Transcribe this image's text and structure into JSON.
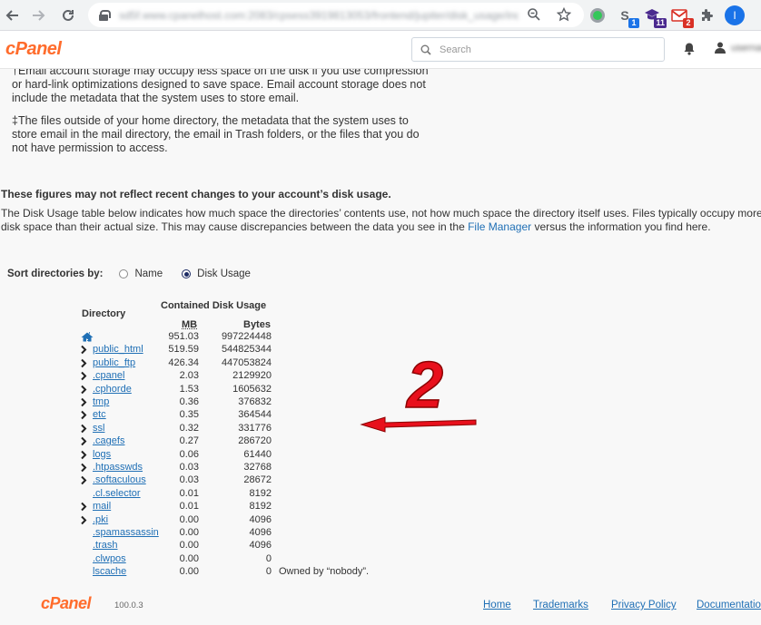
{
  "browser": {
    "url": "sd5f.www.cpanelhost.com:2083/cpsess3919813053/frontend/jupiter/disk_usage/index.html",
    "badges": {
      "ext_s": "1",
      "ext_grad": "11",
      "ext_mail": "2"
    },
    "profile_initial": "I"
  },
  "header": {
    "logo": "cPanel",
    "search_placeholder": "Search",
    "user_name": "username"
  },
  "notes": {
    "storage_note": "†Email account storage may occupy less space on the disk if you use compression or hard-link optimizations designed to save space. Email account storage does not include the metadata that the system uses to store email.",
    "outside_note": "‡The files outside of your home directory, the metadata that the system uses to store email in the mail directory, the email in Trash folders, or the files that you do not have permission to access."
  },
  "warning_heading": "These figures may not reflect recent changes to your account’s disk usage.",
  "description": {
    "before": "The Disk Usage table below indicates how much space the directories’ contents use, not how much space the directory itself uses. Files typically occupy more disk space than their actual size. This may cause discrepancies between the data you see in the ",
    "link": "File Manager",
    "after": " versus the information you find here."
  },
  "sort": {
    "label": "Sort directories by:",
    "options": [
      {
        "label": "Name",
        "checked": false
      },
      {
        "label": "Disk Usage",
        "checked": true
      }
    ]
  },
  "table": {
    "col_directory": "Directory",
    "col_contained": "Contained Disk Usage",
    "col_mb": "MB",
    "col_bytes": "Bytes",
    "rows": [
      {
        "name": "/",
        "mb": "951.03",
        "bytes": "997224448",
        "expandable": false,
        "home": true,
        "note": ""
      },
      {
        "name": "public_html",
        "mb": "519.59",
        "bytes": "544825344",
        "expandable": true,
        "home": false,
        "note": ""
      },
      {
        "name": "public_ftp",
        "mb": "426.34",
        "bytes": "447053824",
        "expandable": true,
        "home": false,
        "note": ""
      },
      {
        "name": ".cpanel",
        "mb": "2.03",
        "bytes": "2129920",
        "expandable": true,
        "home": false,
        "note": ""
      },
      {
        "name": ".cphorde",
        "mb": "1.53",
        "bytes": "1605632",
        "expandable": true,
        "home": false,
        "note": ""
      },
      {
        "name": "tmp",
        "mb": "0.36",
        "bytes": "376832",
        "expandable": true,
        "home": false,
        "note": ""
      },
      {
        "name": "etc",
        "mb": "0.35",
        "bytes": "364544",
        "expandable": true,
        "home": false,
        "note": ""
      },
      {
        "name": "ssl",
        "mb": "0.32",
        "bytes": "331776",
        "expandable": true,
        "home": false,
        "note": ""
      },
      {
        "name": ".cagefs",
        "mb": "0.27",
        "bytes": "286720",
        "expandable": true,
        "home": false,
        "note": ""
      },
      {
        "name": "logs",
        "mb": "0.06",
        "bytes": "61440",
        "expandable": true,
        "home": false,
        "note": ""
      },
      {
        "name": ".htpasswds",
        "mb": "0.03",
        "bytes": "32768",
        "expandable": true,
        "home": false,
        "note": ""
      },
      {
        "name": ".softaculous",
        "mb": "0.03",
        "bytes": "28672",
        "expandable": true,
        "home": false,
        "note": ""
      },
      {
        "name": ".cl.selector",
        "mb": "0.01",
        "bytes": "8192",
        "expandable": false,
        "home": false,
        "note": ""
      },
      {
        "name": "mail",
        "mb": "0.01",
        "bytes": "8192",
        "expandable": true,
        "home": false,
        "note": ""
      },
      {
        "name": ".pki",
        "mb": "0.00",
        "bytes": "4096",
        "expandable": true,
        "home": false,
        "note": ""
      },
      {
        "name": ".spamassassin",
        "mb": "0.00",
        "bytes": "4096",
        "expandable": false,
        "home": false,
        "note": ""
      },
      {
        "name": ".trash",
        "mb": "0.00",
        "bytes": "4096",
        "expandable": false,
        "home": false,
        "note": ""
      },
      {
        "name": ".clwpos",
        "mb": "0.00",
        "bytes": "0",
        "expandable": false,
        "home": false,
        "note": ""
      },
      {
        "name": "lscache",
        "mb": "0.00",
        "bytes": "0",
        "expandable": false,
        "home": false,
        "note": "Owned by “nobody”."
      }
    ]
  },
  "annotation": {
    "number": "2",
    "color": "#e8101c"
  },
  "footer": {
    "logo": "cPanel",
    "version": "100.0.3",
    "links": [
      "Home",
      "Trademarks",
      "Privacy Policy",
      "Documentation"
    ]
  },
  "colors": {
    "brand": "#ff6c2c",
    "link": "#1f6fb5",
    "radio_checked": "#1c2a63"
  }
}
